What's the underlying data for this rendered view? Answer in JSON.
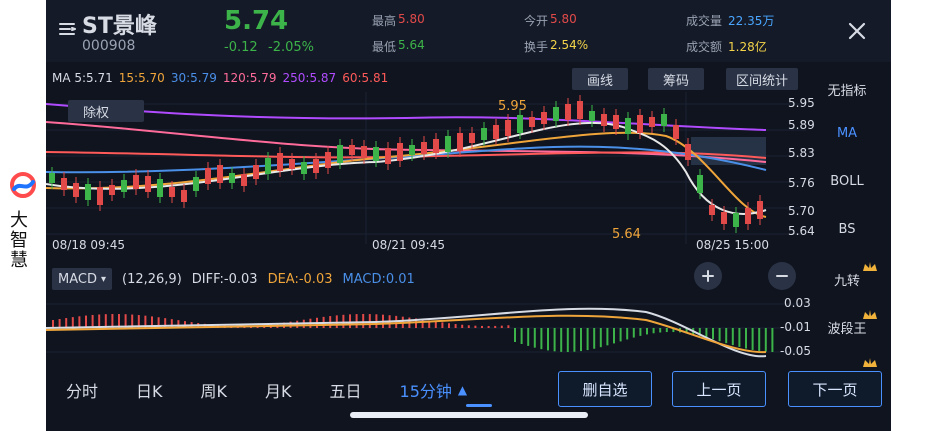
{
  "brand": {
    "line1": "大",
    "line2": "智",
    "line3": "慧"
  },
  "header": {
    "name": "ST景峰",
    "code": "000908",
    "price": "5.74",
    "change": "-0.12",
    "change_pct": "-2.05%",
    "high_label": "最高",
    "high": "5.80",
    "low_label": "最低",
    "low": "5.64",
    "open_label": "今开",
    "open": "5.80",
    "turnover_label": "换手",
    "turnover": "2.54%",
    "volume_label": "成交量",
    "volume": "22.35万",
    "amount_label": "成交额",
    "amount": "1.28亿"
  },
  "ma_bar": {
    "items": [
      {
        "text": "MA 5:5.71",
        "color": "#d7dbe4"
      },
      {
        "text": "15:5.70",
        "color": "#f0a53b"
      },
      {
        "text": "30:5.79",
        "color": "#4a8fe8"
      },
      {
        "text": "120:5.79",
        "color": "#ff6b9a"
      },
      {
        "text": "250:5.87",
        "color": "#b14bff"
      },
      {
        "text": "60:5.81",
        "color": "#ff5a5a"
      }
    ],
    "tools": [
      "画线",
      "筹码",
      "区间统计"
    ]
  },
  "chart": {
    "adjust_label": "除权",
    "y_ticks": [
      "5.95",
      "5.89",
      "5.83",
      "5.76",
      "5.70",
      "5.64"
    ],
    "x_ticks": [
      "08/18  09:45",
      "08/21  09:45",
      "08/25  15:00"
    ],
    "high_marker": "5.95",
    "low_marker": "5.64"
  },
  "macd": {
    "selector": "MACD",
    "params": "(12,26,9)",
    "diff": "DIFF:-0.03",
    "dea": "DEA:-0.03",
    "macd": "MACD:0.01",
    "y_ticks": [
      "0.03",
      "-0.01",
      "-0.05"
    ],
    "colors": {
      "diff": "#d7dbe4",
      "dea": "#f0a53b",
      "macd": "#4a8fe8",
      "pos": "#e24a4a",
      "neg": "#3cb44a"
    }
  },
  "right_menu": {
    "items": [
      "无指标",
      "MA",
      "BOLL",
      "BS",
      "九转",
      "波段王"
    ],
    "active": "MA"
  },
  "bottom_tabs": {
    "items": [
      "分时",
      "日K",
      "周K",
      "月K",
      "五日",
      "15分钟"
    ],
    "active": "15分钟"
  },
  "bottom_buttons": {
    "remove_fav": "删自选",
    "prev": "上一页",
    "next": "下一页"
  },
  "chart_data": {
    "type": "table",
    "title": "",
    "series": []
  },
  "colors": {
    "bg": "#0f141e",
    "up": "#e24a4a",
    "down": "#3cb44a",
    "accent": "#4a90ff",
    "price_up": "#3cb44a",
    "price_down": "#3cb44a"
  }
}
